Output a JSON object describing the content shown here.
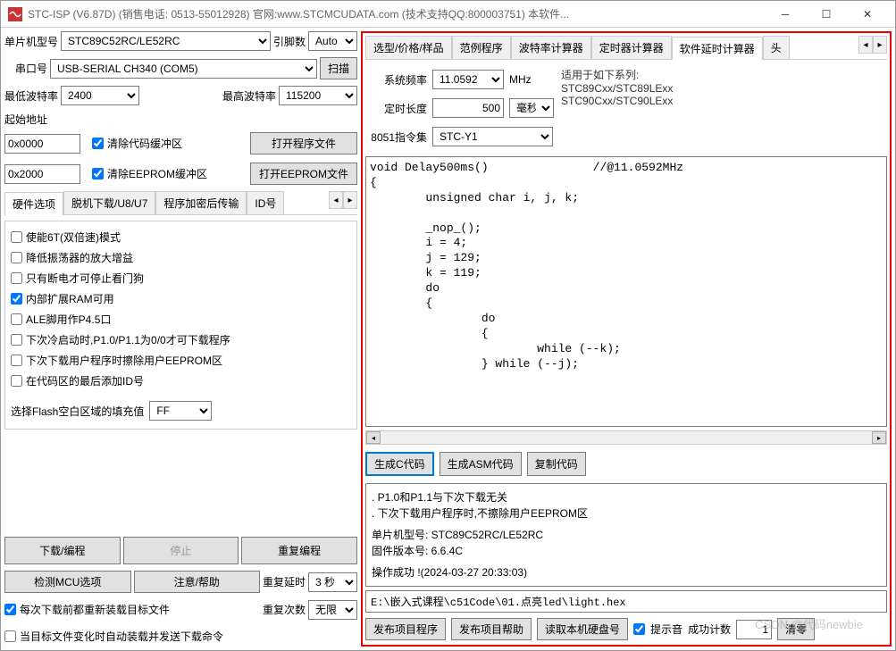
{
  "titlebar": "STC-ISP (V6.87D) (销售电话: 0513-55012928) 官网:www.STCMCUDATA.com  (技术支持QQ:800003751) 本软件...",
  "left": {
    "mcu_label": "单片机型号",
    "mcu_value": "STC89C52RC/LE52RC",
    "pins_label": "引脚数",
    "pins_value": "Auto",
    "com_label": "串口号",
    "com_value": "USB-SERIAL CH340 (COM5)",
    "scan_btn": "扫描",
    "min_baud_label": "最低波特率",
    "min_baud_value": "2400",
    "max_baud_label": "最高波特率",
    "max_baud_value": "115200",
    "start_addr_label": "起始地址",
    "addr1": "0x0000",
    "clear_code_label": "清除代码缓冲区",
    "addr2": "0x2000",
    "clear_eeprom_label": "清除EEPROM缓冲区",
    "open_program_btn": "打开程序文件",
    "open_eeprom_btn": "打开EEPROM文件",
    "hw_tabs": [
      "硬件选项",
      "脱机下载/U8/U7",
      "程序加密后传输",
      "ID号"
    ],
    "opts": {
      "o1": "使能6T(双倍速)模式",
      "o2": "降低振荡器的放大增益",
      "o3": "只有断电才可停止看门狗",
      "o4": "内部扩展RAM可用",
      "o5": "ALE脚用作P4.5口",
      "o6": "下次冷启动时,P1.0/P1.1为0/0才可下载程序",
      "o7": "下次下载用户程序时擦除用户EEPROM区",
      "o8": "在代码区的最后添加ID号"
    },
    "flash_fill_label": "选择Flash空白区域的填充值",
    "flash_fill_value": "FF",
    "download_btn": "下载/编程",
    "stop_btn": "停止",
    "reprogram_btn": "重复编程",
    "check_mcu_btn": "检测MCU选项",
    "help_btn": "注意/帮助",
    "repeat_delay_label": "重复延时",
    "repeat_delay_value": "3 秒",
    "repeat_count_label": "重复次数",
    "repeat_count_value": "无限",
    "reload_label": "每次下载前都重新装载目标文件",
    "auto_label": "当目标文件变化时自动装载并发送下载命令"
  },
  "right": {
    "tabs": [
      "选型/价格/样品",
      "范例程序",
      "波特率计算器",
      "定时器计算器",
      "软件延时计算器",
      "头"
    ],
    "freq_label": "系统频率",
    "freq_value": "11.0592",
    "freq_unit": "MHz",
    "timer_label": "定时长度",
    "timer_value": "500",
    "timer_unit": "毫秒",
    "inst_label": "8051指令集",
    "inst_value": "STC-Y1",
    "applies_title": "适用于如下系列:",
    "applies_l1": "STC89Cxx/STC89LExx",
    "applies_l2": "STC90Cxx/STC90LExx",
    "code": "void Delay500ms()               //@11.0592MHz\n{\n        unsigned char i, j, k;\n\n        _nop_();\n        i = 4;\n        j = 129;\n        k = 119;\n        do\n        {\n                do\n                {\n                        while (--k);\n                } while (--j);",
    "gen_c_btn": "生成C代码",
    "gen_asm_btn": "生成ASM代码",
    "copy_btn": "复制代码",
    "info_l1": ". P1.0和P1.1与下次下载无关",
    "info_l2": ". 下次下载用户程序时,不擦除用户EEPROM区",
    "info_l3": "单片机型号: STC89C52RC/LE52RC",
    "info_l4": "固件版本号: 6.6.4C",
    "info_l5": "操作成功 !(2024-03-27 20:33:03)",
    "path": "E:\\嵌入式课程\\c51Code\\01.点亮led\\light.hex",
    "pub_prog_btn": "发布项目程序",
    "pub_help_btn": "发布项目帮助",
    "read_hd_btn": "读取本机硬盘号",
    "sound_label": "提示音",
    "count_label": "成功计数",
    "count_value": "1",
    "clear_btn": "清零"
  },
  "watermark": "CSDN @代码newbie"
}
